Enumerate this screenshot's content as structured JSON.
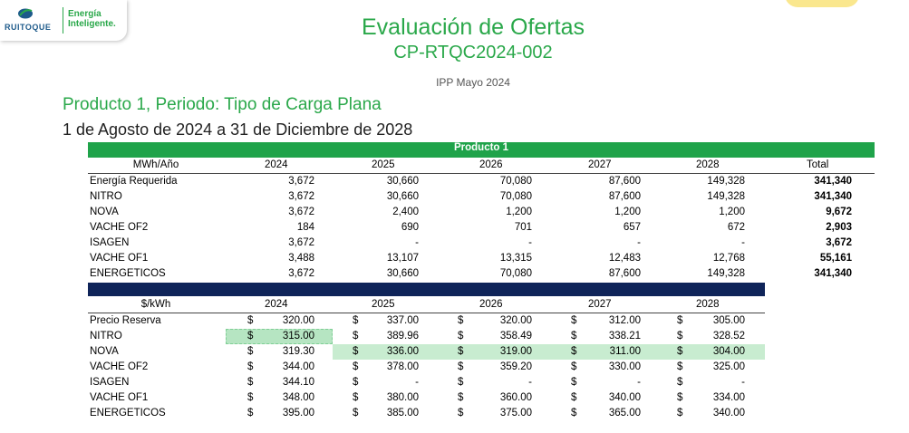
{
  "logo": {
    "name": "RUITOQUE",
    "tagline_1": "Energía",
    "tagline_2": "Inteligente."
  },
  "title": "Evaluación de Ofertas",
  "code": "CP-RTQC2024-002",
  "ipp": "IPP Mayo 2024",
  "product_heading": "Producto 1, Periodo: Tipo de Carga Plana",
  "date_range": "1 de Agosto de 2024 a 31 de Diciembre de 2028",
  "energy_table": {
    "banner": "Producto 1",
    "unit": "MWh/Año",
    "years": [
      "2024",
      "2025",
      "2026",
      "2027",
      "2028"
    ],
    "total_label": "Total",
    "rows": [
      {
        "name": "Energía Requerida",
        "values": [
          "3,672",
          "30,660",
          "70,080",
          "87,600",
          "149,328"
        ],
        "total": "341,340"
      },
      {
        "name": "NITRO",
        "values": [
          "3,672",
          "30,660",
          "70,080",
          "87,600",
          "149,328"
        ],
        "total": "341,340"
      },
      {
        "name": "NOVA",
        "values": [
          "3,672",
          "2,400",
          "1,200",
          "1,200",
          "1,200"
        ],
        "total": "9,672"
      },
      {
        "name": "VACHE OF2",
        "values": [
          "184",
          "690",
          "701",
          "657",
          "672"
        ],
        "total": "2,903"
      },
      {
        "name": "ISAGEN",
        "values": [
          "3,672",
          "-",
          "-",
          "-",
          "-"
        ],
        "total": "3,672"
      },
      {
        "name": "VACHE OF1",
        "values": [
          "3,488",
          "13,107",
          "13,315",
          "12,483",
          "12,768"
        ],
        "total": "55,161"
      },
      {
        "name": "ENERGETICOS",
        "values": [
          "3,672",
          "30,660",
          "70,080",
          "87,600",
          "149,328"
        ],
        "total": "341,340"
      }
    ]
  },
  "price_table": {
    "unit": "$/kWh",
    "currency": "$",
    "years": [
      "2024",
      "2025",
      "2026",
      "2027",
      "2028"
    ],
    "rows": [
      {
        "name": "Precio Reserva",
        "values": [
          "320.00",
          "337.00",
          "320.00",
          "312.00",
          "305.00"
        ]
      },
      {
        "name": "NITRO",
        "values": [
          "315.00",
          "389.96",
          "358.49",
          "338.21",
          "328.52"
        ]
      },
      {
        "name": "NOVA",
        "values": [
          "319.30",
          "336.00",
          "319.00",
          "311.00",
          "304.00"
        ]
      },
      {
        "name": "VACHE OF2",
        "values": [
          "344.00",
          "378.00",
          "359.20",
          "330.00",
          "325.00"
        ]
      },
      {
        "name": "ISAGEN",
        "values": [
          "344.10",
          "-",
          "-",
          "-",
          "-"
        ]
      },
      {
        "name": "VACHE OF1",
        "values": [
          "348.00",
          "380.00",
          "360.00",
          "340.00",
          "334.00"
        ]
      },
      {
        "name": "ENERGETICOS",
        "values": [
          "395.00",
          "385.00",
          "375.00",
          "365.00",
          "340.00"
        ]
      }
    ]
  },
  "colors": {
    "brand_green": "#2aa84a",
    "banner_green": "#1fa34a",
    "navy": "#0f2459",
    "highlight": "#c8ecd0"
  }
}
